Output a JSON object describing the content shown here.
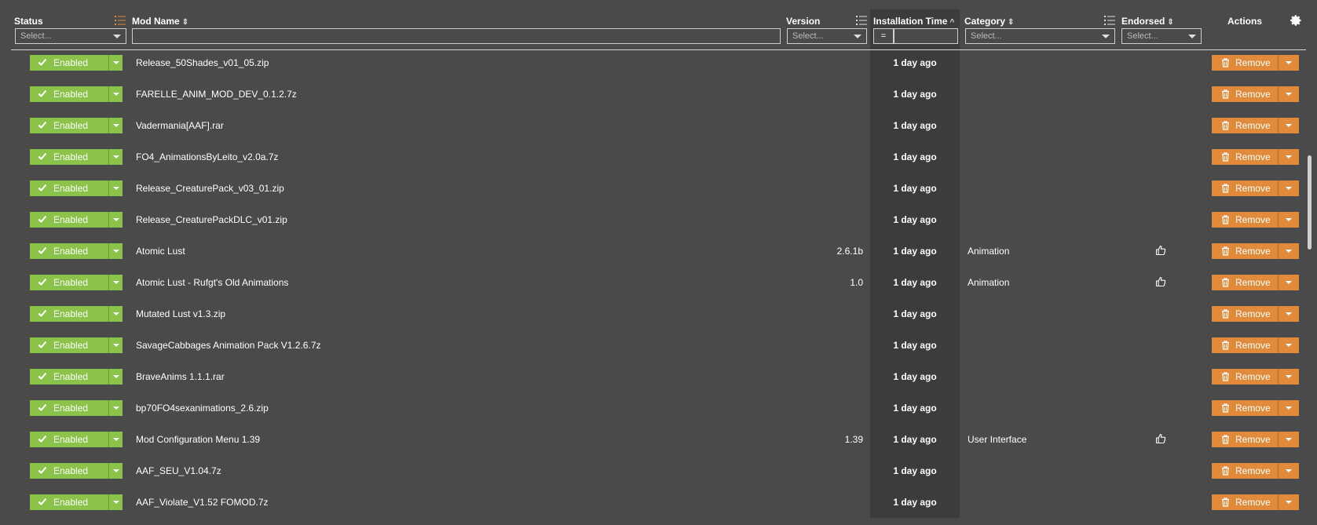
{
  "header": {
    "status_label": "Status",
    "mod_name_label": "Mod Name",
    "version_label": "Version",
    "installation_time_label": "Installation Time",
    "category_label": "Category",
    "endorsed_label": "Endorsed",
    "actions_label": "Actions",
    "status_filter_placeholder": "Select...",
    "version_filter_placeholder": "Select...",
    "category_filter_placeholder": "Select...",
    "endorsed_filter_placeholder": "Select...",
    "mod_name_filter_value": "",
    "install_time_operator": "=",
    "install_time_filter_value": ""
  },
  "colors": {
    "background": "#4a4a4a",
    "enabled_green": "#8bc34a",
    "remove_orange": "#e08a3a",
    "highlight_column": "#3c3c3c"
  },
  "icons": {
    "status": "check-icon",
    "remove": "trash-icon",
    "endorse": "thumbs-up-icon",
    "settings": "gear-icon"
  },
  "rows": [
    {
      "status": "Enabled",
      "name": "Release_50Shades_v01_05.zip",
      "version": "",
      "time": "1 day ago",
      "category": "",
      "endorse": false,
      "action": "Remove"
    },
    {
      "status": "Enabled",
      "name": "FARELLE_ANIM_MOD_DEV_0.1.2.7z",
      "version": "",
      "time": "1 day ago",
      "category": "",
      "endorse": false,
      "action": "Remove"
    },
    {
      "status": "Enabled",
      "name": "Vadermania[AAF].rar",
      "version": "",
      "time": "1 day ago",
      "category": "",
      "endorse": false,
      "action": "Remove"
    },
    {
      "status": "Enabled",
      "name": "FO4_AnimationsByLeito_v2.0a.7z",
      "version": "",
      "time": "1 day ago",
      "category": "",
      "endorse": false,
      "action": "Remove"
    },
    {
      "status": "Enabled",
      "name": "Release_CreaturePack_v03_01.zip",
      "version": "",
      "time": "1 day ago",
      "category": "",
      "endorse": false,
      "action": "Remove"
    },
    {
      "status": "Enabled",
      "name": "Release_CreaturePackDLC_v01.zip",
      "version": "",
      "time": "1 day ago",
      "category": "",
      "endorse": false,
      "action": "Remove"
    },
    {
      "status": "Enabled",
      "name": "Atomic Lust",
      "version": "2.6.1b",
      "time": "1 day ago",
      "category": "Animation",
      "endorse": true,
      "action": "Remove"
    },
    {
      "status": "Enabled",
      "name": "Atomic Lust - Rufgt's Old Animations",
      "version": "1.0",
      "time": "1 day ago",
      "category": "Animation",
      "endorse": true,
      "action": "Remove"
    },
    {
      "status": "Enabled",
      "name": "Mutated Lust v1.3.zip",
      "version": "",
      "time": "1 day ago",
      "category": "",
      "endorse": false,
      "action": "Remove"
    },
    {
      "status": "Enabled",
      "name": "SavageCabbages Animation Pack V1.2.6.7z",
      "version": "",
      "time": "1 day ago",
      "category": "",
      "endorse": false,
      "action": "Remove"
    },
    {
      "status": "Enabled",
      "name": "BraveAnims 1.1.1.rar",
      "version": "",
      "time": "1 day ago",
      "category": "",
      "endorse": false,
      "action": "Remove"
    },
    {
      "status": "Enabled",
      "name": "bp70FO4sexanimations_2.6.zip",
      "version": "",
      "time": "1 day ago",
      "category": "",
      "endorse": false,
      "action": "Remove"
    },
    {
      "status": "Enabled",
      "name": "Mod Configuration Menu 1.39",
      "version": "1.39",
      "time": "1 day ago",
      "category": "User Interface",
      "endorse": true,
      "action": "Remove"
    },
    {
      "status": "Enabled",
      "name": "AAF_SEU_V1.04.7z",
      "version": "",
      "time": "1 day ago",
      "category": "",
      "endorse": false,
      "action": "Remove"
    },
    {
      "status": "Enabled",
      "name": "AAF_Violate_V1.52 FOMOD.7z",
      "version": "",
      "time": "1 day ago",
      "category": "",
      "endorse": false,
      "action": "Remove"
    }
  ]
}
